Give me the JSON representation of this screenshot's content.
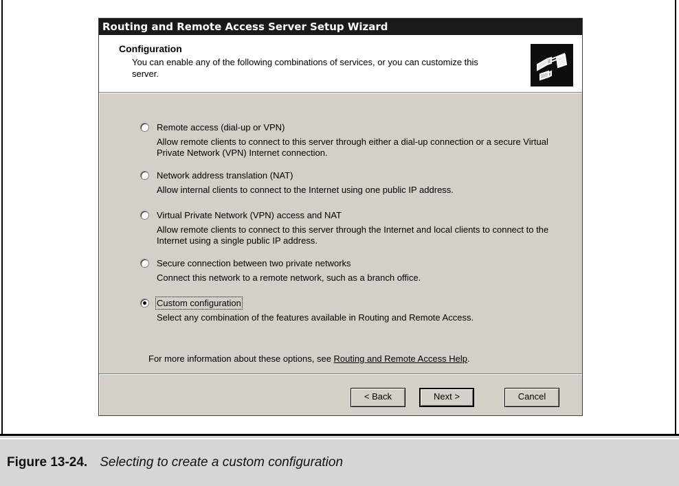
{
  "window": {
    "title": "Routing and Remote Access Server Setup Wizard"
  },
  "header": {
    "title": "Configuration",
    "subtitle": "You can enable any of the following combinations of services, or you can customize this server.",
    "icon": "network-cable-icon"
  },
  "options": [
    {
      "label": "Remote access (dial-up or VPN)",
      "description": "Allow remote clients to connect to this server through either a dial-up connection or a secure Virtual Private Network (VPN) Internet connection.",
      "selected": false
    },
    {
      "label": "Network address translation (NAT)",
      "description": "Allow internal clients to connect to the Internet using one public IP address.",
      "selected": false
    },
    {
      "label": "Virtual Private Network (VPN) access and NAT",
      "description": "Allow remote clients to connect to this server through the Internet and local clients to connect to the Internet using a single public IP address.",
      "selected": false
    },
    {
      "label": "Secure connection between two private networks",
      "description": "Connect this network to a remote network, such as a branch office.",
      "selected": false
    },
    {
      "label": "Custom configuration",
      "description": "Select any combination of the features available in Routing and Remote Access.",
      "selected": true
    }
  ],
  "footer": {
    "text": "For more information about these options, see ",
    "link": "Routing and Remote Access Help",
    "end": "."
  },
  "buttons": {
    "back": "< Back",
    "next": "Next >",
    "cancel": "Cancel"
  },
  "caption": {
    "label": "Figure 13-24.",
    "text": "Selecting to create a custom configuration"
  }
}
